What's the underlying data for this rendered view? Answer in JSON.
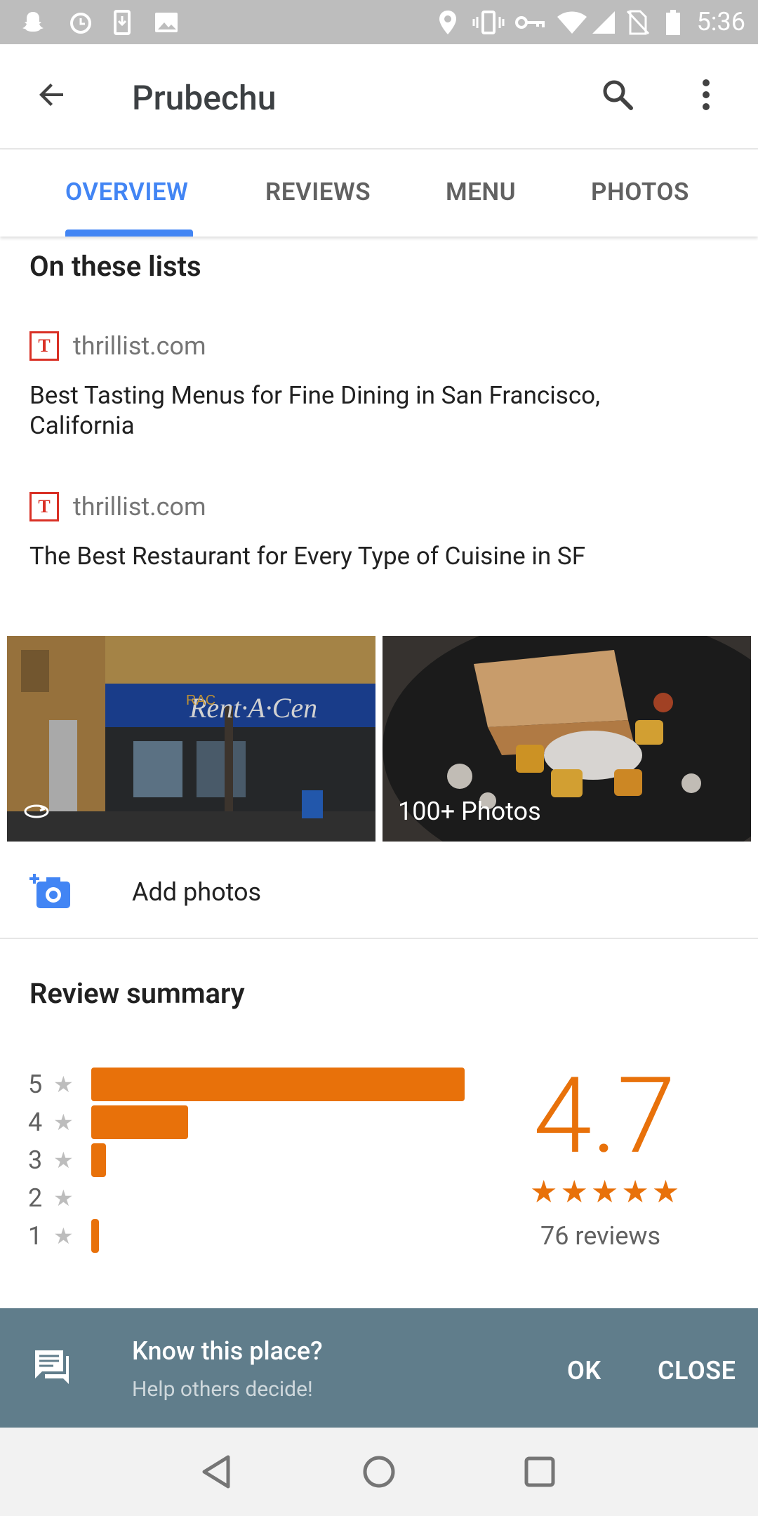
{
  "status_bar": {
    "time": "5:36"
  },
  "app_bar": {
    "title": "Prubechu"
  },
  "tabs": [
    {
      "label": "OVERVIEW",
      "active": true
    },
    {
      "label": "REVIEWS"
    },
    {
      "label": "MENU"
    },
    {
      "label": "PHOTOS"
    }
  ],
  "lists": {
    "title": "On these lists",
    "items": [
      {
        "source": "thrillist.com",
        "logo": "T",
        "description": "Best Tasting Menus for Fine Dining in San Francisco, California"
      },
      {
        "source": "thrillist.com",
        "logo": "T",
        "description": "The Best Restaurant for Every Type of Cuisine in SF"
      }
    ]
  },
  "photos": {
    "storefront_sign": "Rent·A·Cen",
    "storefront_sign_small": "RAC",
    "count_label": "100+ Photos",
    "add_label": "Add photos"
  },
  "review_summary": {
    "title": "Review summary",
    "rating": "4.7",
    "stars": "★★★★★",
    "reviews_label": "76 reviews",
    "accent_color": "#e8710a",
    "distribution": [
      {
        "stars": "5",
        "star_icon": "★",
        "share": 1.0
      },
      {
        "stars": "4",
        "star_icon": "★",
        "share": 0.26
      },
      {
        "stars": "3",
        "star_icon": "★",
        "share": 0.04
      },
      {
        "stars": "2",
        "star_icon": "★",
        "share": 0.0
      },
      {
        "stars": "1",
        "star_icon": "★",
        "share": 0.02
      }
    ]
  },
  "snackbar": {
    "title": "Know this place?",
    "subtitle": "Help others decide!",
    "ok_label": "OK",
    "close_label": "CLOSE",
    "background": "#607d8b"
  }
}
